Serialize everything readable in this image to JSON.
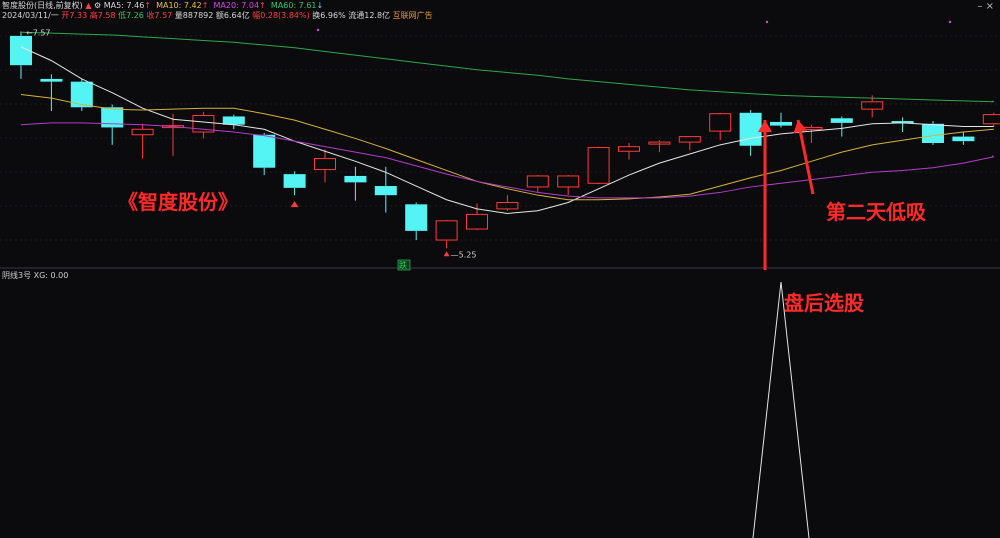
{
  "header": {
    "stock_name": "智度股份(日线,前复权)",
    "ma5": "MA5: 7.46",
    "ma10": "MA10: 7.42",
    "ma20": "MA20: 7.04",
    "ma60": "MA60: 7.61",
    "date": "2024/03/11/一",
    "open": "开7.33",
    "high": "高7.58",
    "low": "低7.26",
    "close": "收7.57",
    "volume": "量887892",
    "amount": "额6.64亿",
    "change": "幅0.28(3.84%)",
    "turnover": "换6.96%",
    "float": "流通12.8亿",
    "sector": "互联网广告"
  },
  "annotations": {
    "title": "《智度股份》",
    "low_buy": "第二天低吸",
    "after_close": "盘后选股"
  },
  "chart_labels": {
    "high_price": "7.57",
    "low_price": "5.25",
    "drop_badge": "跌"
  },
  "lower_panel": {
    "indicator": "阴线3号 XG: 0.00"
  },
  "colors": {
    "up": "#ff3a3a",
    "down": "#55f4f4",
    "ma5": "#e6e6e6",
    "ma10": "#d6b23a",
    "ma20": "#b43cc8",
    "ma60": "#2fa84a",
    "annotation": "#ff2a2a"
  },
  "chart_data": {
    "type": "candlestick",
    "candles": [
      {
        "o": 7.57,
        "h": 7.62,
        "l": 7.1,
        "c": 7.25
      },
      {
        "o": 7.1,
        "h": 7.15,
        "l": 6.75,
        "c": 7.07
      },
      {
        "o": 7.07,
        "h": 7.1,
        "l": 6.75,
        "c": 6.79
      },
      {
        "o": 6.79,
        "h": 6.82,
        "l": 6.38,
        "c": 6.57
      },
      {
        "o": 6.49,
        "h": 6.61,
        "l": 6.23,
        "c": 6.55
      },
      {
        "o": 6.57,
        "h": 6.72,
        "l": 6.26,
        "c": 6.59
      },
      {
        "o": 6.52,
        "h": 6.74,
        "l": 6.45,
        "c": 6.7
      },
      {
        "o": 6.69,
        "h": 6.71,
        "l": 6.55,
        "c": 6.6
      },
      {
        "o": 6.49,
        "h": 6.51,
        "l": 6.05,
        "c": 6.13
      },
      {
        "o": 6.06,
        "h": 6.09,
        "l": 5.83,
        "c": 5.91
      },
      {
        "o": 6.11,
        "h": 6.33,
        "l": 5.97,
        "c": 6.23
      },
      {
        "o": 6.04,
        "h": 6.14,
        "l": 5.77,
        "c": 5.97
      },
      {
        "o": 5.93,
        "h": 6.14,
        "l": 5.64,
        "c": 5.83
      },
      {
        "o": 5.73,
        "h": 5.75,
        "l": 5.34,
        "c": 5.44
      },
      {
        "o": 5.34,
        "h": 5.56,
        "l": 5.25,
        "c": 5.55
      },
      {
        "o": 5.46,
        "h": 5.74,
        "l": 5.45,
        "c": 5.62
      },
      {
        "o": 5.68,
        "h": 5.83,
        "l": 5.66,
        "c": 5.75
      },
      {
        "o": 5.92,
        "h": 6.05,
        "l": 5.86,
        "c": 6.04
      },
      {
        "o": 5.92,
        "h": 6.05,
        "l": 5.83,
        "c": 6.04
      },
      {
        "o": 5.96,
        "h": 6.36,
        "l": 5.95,
        "c": 6.35
      },
      {
        "o": 6.31,
        "h": 6.4,
        "l": 6.22,
        "c": 6.36
      },
      {
        "o": 6.4,
        "h": 6.43,
        "l": 6.3,
        "c": 6.41
      },
      {
        "o": 6.41,
        "h": 6.47,
        "l": 6.32,
        "c": 6.47
      },
      {
        "o": 6.53,
        "h": 6.73,
        "l": 6.43,
        "c": 6.72
      },
      {
        "o": 6.73,
        "h": 6.76,
        "l": 6.26,
        "c": 6.37
      },
      {
        "o": 6.63,
        "h": 6.73,
        "l": 6.57,
        "c": 6.59
      },
      {
        "o": 6.55,
        "h": 6.6,
        "l": 6.4,
        "c": 6.57
      },
      {
        "o": 6.67,
        "h": 6.69,
        "l": 6.47,
        "c": 6.62
      },
      {
        "o": 6.77,
        "h": 6.92,
        "l": 6.68,
        "c": 6.85
      },
      {
        "o": 6.64,
        "h": 6.68,
        "l": 6.52,
        "c": 6.62
      },
      {
        "o": 6.61,
        "h": 6.64,
        "l": 6.38,
        "c": 6.4
      },
      {
        "o": 6.47,
        "h": 6.52,
        "l": 6.38,
        "c": 6.42
      },
      {
        "o": 6.61,
        "h": 6.73,
        "l": 6.58,
        "c": 6.71
      }
    ],
    "ma5": [
      7.45,
      7.3,
      7.1,
      6.95,
      6.78,
      6.66,
      6.63,
      6.6,
      6.55,
      6.42,
      6.31,
      6.2,
      6.08,
      5.93,
      5.78,
      5.68,
      5.63,
      5.66,
      5.75,
      5.9,
      6.05,
      6.18,
      6.28,
      6.38,
      6.45,
      6.5,
      6.53,
      6.56,
      6.61,
      6.62,
      6.6,
      6.58,
      6.58
    ],
    "ma10": [
      6.93,
      6.89,
      6.82,
      6.77,
      6.76,
      6.77,
      6.78,
      6.78,
      6.72,
      6.65,
      6.55,
      6.45,
      6.34,
      6.22,
      6.1,
      5.98,
      5.9,
      5.83,
      5.78,
      5.78,
      5.79,
      5.81,
      5.84,
      5.93,
      6.02,
      6.1,
      6.2,
      6.3,
      6.38,
      6.43,
      6.48,
      6.52,
      6.55
    ],
    "ma20": [
      6.6,
      6.62,
      6.62,
      6.61,
      6.6,
      6.58,
      6.55,
      6.52,
      6.48,
      6.42,
      6.36,
      6.3,
      6.24,
      6.15,
      6.06,
      5.98,
      5.92,
      5.86,
      5.82,
      5.8,
      5.8,
      5.8,
      5.82,
      5.86,
      5.92,
      5.96,
      6.0,
      6.04,
      6.08,
      6.1,
      6.13,
      6.18,
      6.25
    ],
    "ma60": [
      7.61,
      7.6,
      7.59,
      7.58,
      7.56,
      7.54,
      7.52,
      7.5,
      7.47,
      7.44,
      7.4,
      7.36,
      7.32,
      7.28,
      7.24,
      7.2,
      7.17,
      7.14,
      7.1,
      7.07,
      7.04,
      7.01,
      6.98,
      6.96,
      6.94,
      6.92,
      6.91,
      6.9,
      6.89,
      6.88,
      6.87,
      6.86,
      6.85
    ],
    "up_arrows": [
      9
    ],
    "indicator_signal_index": 25,
    "ylim": [
      5.1,
      7.7
    ]
  }
}
